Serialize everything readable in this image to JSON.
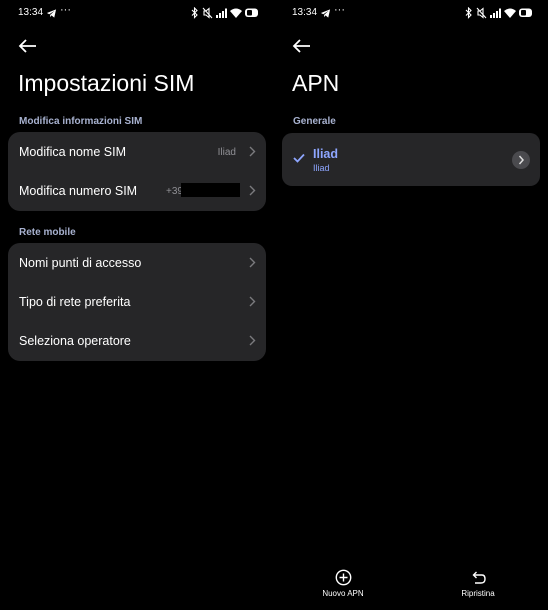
{
  "left": {
    "status": {
      "time": "13:34",
      "overflow": "···"
    },
    "title": "Impostazioni SIM",
    "section_sim": "Modifica informazioni SIM",
    "sim_rows": [
      {
        "label": "Modifica nome SIM",
        "value": "Iliad"
      },
      {
        "label": "Modifica numero SIM",
        "value": "+39"
      }
    ],
    "section_network": "Rete mobile",
    "network_rows": [
      {
        "label": "Nomi punti di accesso"
      },
      {
        "label": "Tipo di rete preferita"
      },
      {
        "label": "Seleziona operatore"
      }
    ]
  },
  "right": {
    "status": {
      "time": "13:34",
      "overflow": "···"
    },
    "title": "APN",
    "section_general": "Generale",
    "apn": {
      "name": "Iliad",
      "subtitle": "Iliad",
      "selected": true
    },
    "bottom": {
      "new_apn": "Nuovo APN",
      "reset": "Ripristina"
    }
  },
  "colors": {
    "background": "#000000",
    "card": "#262628",
    "accent": "#8ea6ff",
    "section": "#a8b2d0"
  },
  "icons": [
    "back-arrow-icon",
    "telegram-icon",
    "bluetooth-icon",
    "mute-icon",
    "signal-icon",
    "wifi-icon",
    "battery-icon",
    "chevron-right-icon",
    "check-icon",
    "add-circle-icon",
    "undo-icon"
  ]
}
